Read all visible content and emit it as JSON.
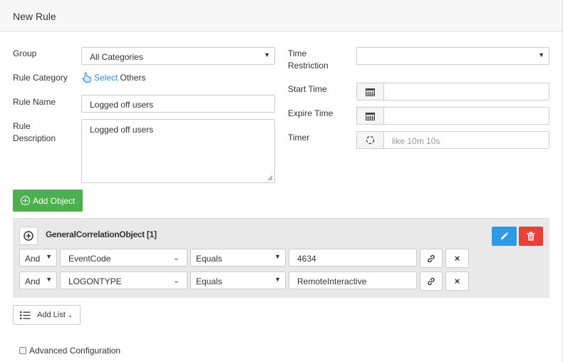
{
  "header": {
    "title": "New Rule"
  },
  "form": {
    "group": {
      "label": "Group",
      "value": "All Categories"
    },
    "rule_category": {
      "label": "Rule Category",
      "link": "Select",
      "others": "Others"
    },
    "rule_name": {
      "label": "Rule Name",
      "value": "Logged off users"
    },
    "rule_description": {
      "label_line1": "Rule",
      "label_line2": "Description",
      "value": "Logged off users"
    },
    "time_restriction": {
      "label_line1": "Time",
      "label_line2": "Restriction",
      "value": ""
    },
    "start_time": {
      "label": "Start Time",
      "value": ""
    },
    "expire_time": {
      "label": "Expire Time",
      "value": ""
    },
    "timer": {
      "label": "Timer",
      "placeholder": "like 10m 10s"
    }
  },
  "add_object_label": "Add Object",
  "object": {
    "title": "GeneralCorrelationObject [1]",
    "conditions": [
      {
        "logic": "And",
        "field": "EventCode",
        "operator": "Equals",
        "value": "4634"
      },
      {
        "logic": "And",
        "field": "LOGONTYPE",
        "operator": "Equals",
        "value": "RemoteInteractive"
      }
    ]
  },
  "add_list_label": "Add List",
  "advanced_label": "Advanced Configuration",
  "colors": {
    "green": "#4caf50",
    "blue": "#2e9ae6",
    "red": "#e8413a",
    "link": "#2e8ad8"
  }
}
